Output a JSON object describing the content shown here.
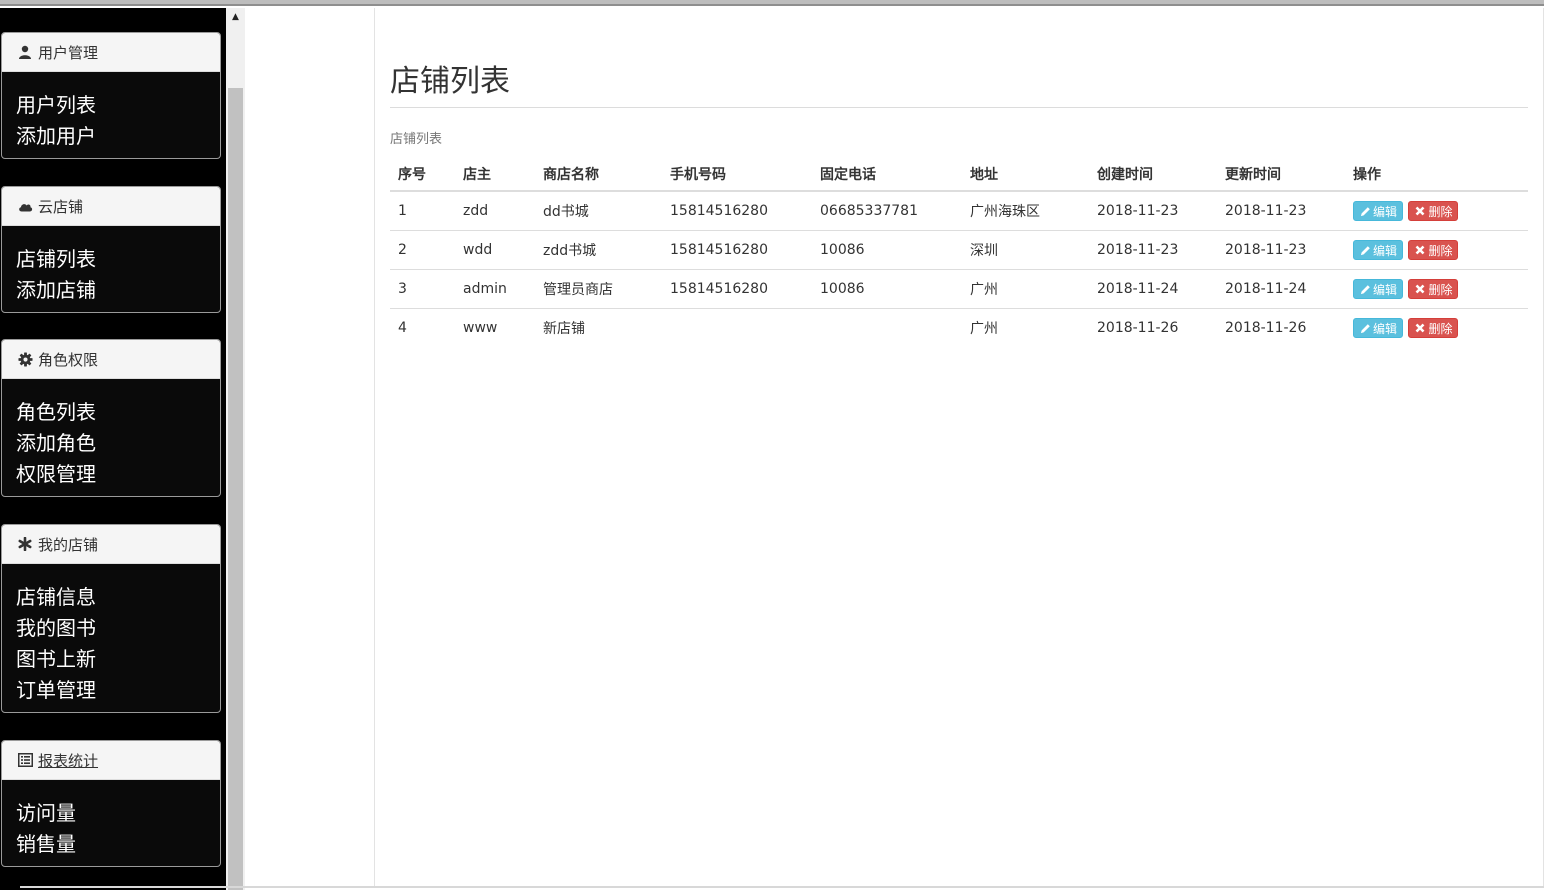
{
  "sidebar": {
    "panels": [
      {
        "icon": "user-icon",
        "title": "用户管理",
        "links": [
          "用户列表",
          "添加用户"
        ]
      },
      {
        "icon": "cloud-icon",
        "title": "云店铺",
        "links": [
          "店铺列表",
          "添加店铺"
        ]
      },
      {
        "icon": "gear-icon",
        "title": "角色权限",
        "links": [
          "角色列表",
          "添加角色",
          "权限管理"
        ]
      },
      {
        "icon": "asterisk-icon",
        "title": "我的店铺",
        "links": [
          "店铺信息",
          "我的图书",
          "图书上新",
          "订单管理"
        ]
      },
      {
        "icon": "list-alt-icon",
        "title": "报表统计",
        "links": [
          "访问量",
          "销售量"
        ]
      }
    ]
  },
  "main": {
    "title": "店铺列表",
    "caption": "店铺列表",
    "columns": [
      "序号",
      "店主",
      "商店名称",
      "手机号码",
      "固定电话",
      "地址",
      "创建时间",
      "更新时间",
      "操作"
    ],
    "rows": [
      [
        "1",
        "zdd",
        "dd书城",
        "15814516280",
        "06685337781",
        "广州海珠区",
        "2018-11-23",
        "2018-11-23"
      ],
      [
        "2",
        "wdd",
        "zdd书城",
        "15814516280",
        "10086",
        "深圳",
        "2018-11-23",
        "2018-11-23"
      ],
      [
        "3",
        "admin",
        "管理员商店",
        "15814516280",
        "10086",
        "广州",
        "2018-11-24",
        "2018-11-24"
      ],
      [
        "4",
        "www",
        "新店铺",
        "",
        "",
        "广州",
        "2018-11-26",
        "2018-11-26"
      ]
    ],
    "edit_label": "编辑",
    "delete_label": "删除"
  },
  "colors": {
    "sidebar_bg": "#000000",
    "edit_btn": "#5bc0de",
    "delete_btn": "#d9534f"
  }
}
